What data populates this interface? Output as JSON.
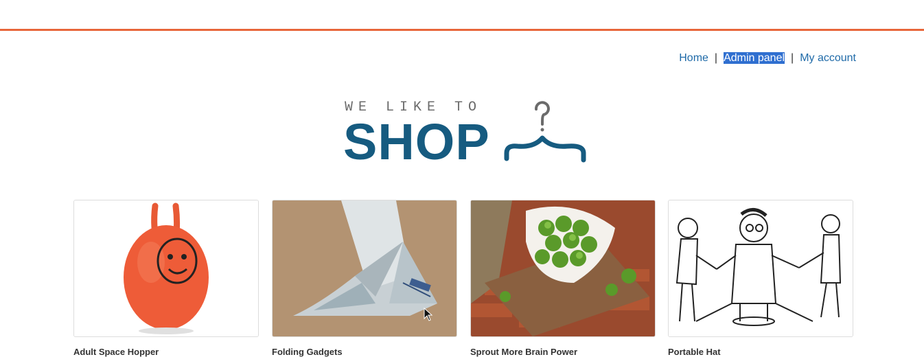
{
  "header": {
    "accent_color": "#e8663a"
  },
  "nav": {
    "home": "Home",
    "separator_1": "|",
    "admin": "Admin panel",
    "separator_2": "|",
    "account": "My account"
  },
  "logo": {
    "tagline": "WE LIKE TO",
    "word": "SHOP",
    "brand_color": "#165b80"
  },
  "products": [
    {
      "title": "Adult Space Hopper",
      "image": "orange-space-hopper"
    },
    {
      "title": "Folding Gadgets",
      "image": "origami-paper-bird"
    },
    {
      "title": "Sprout More Brain Power",
      "image": "brussels-sprouts-bowl"
    },
    {
      "title": "Portable Hat",
      "image": "sketch-tug-of-war"
    }
  ]
}
